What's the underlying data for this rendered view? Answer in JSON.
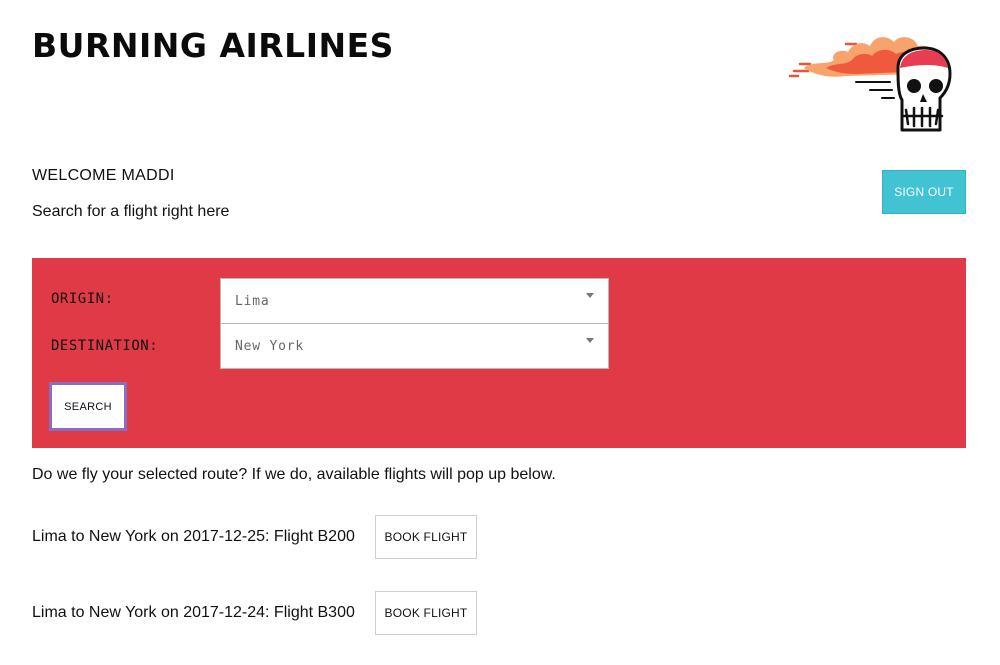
{
  "header": {
    "title": "BURNING AIRLINES",
    "logo_icon": "flaming-skull-icon"
  },
  "user": {
    "welcome": "WELCOME MADDI",
    "hint": "Search for a flight right here",
    "sign_out_label": "SIGN OUT"
  },
  "search": {
    "origin_label": "ORIGIN:",
    "origin_value": "Lima",
    "destination_label": "DESTINATION:",
    "destination_value": "New York",
    "search_label": "SEARCH"
  },
  "results": {
    "note": "Do we fly your selected route? If we do, available flights will pop up below.",
    "flights": [
      {
        "text": "Lima to New York on 2017-12-25: Flight B200",
        "button": "BOOK FLIGHT"
      },
      {
        "text": "Lima to New York on 2017-12-24: Flight B300",
        "button": "BOOK FLIGHT"
      }
    ]
  },
  "colors": {
    "panel": "#e03a46",
    "sign_out": "#41c3d3",
    "search_border": "#8a6cc0"
  }
}
